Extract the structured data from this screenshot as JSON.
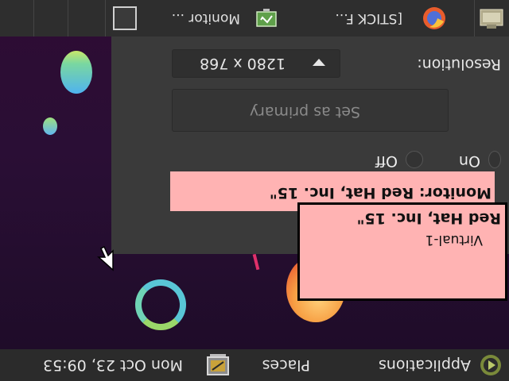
{
  "top_panel": {
    "applications": "Applications",
    "places": "Places",
    "clock": "Mon Oct 23, 09:53"
  },
  "bottom_panel": {
    "tasks": [
      {
        "label": "Monitor ..."
      },
      {
        "label": "[STICK F..."
      }
    ]
  },
  "monitor_label": {
    "name": "Red Hat, Inc. 15\"",
    "connector": "Virtual-1"
  },
  "dialog": {
    "monitor_title": "Monitor: Red Hat, Inc. 15\"",
    "power_on": "On",
    "power_off": "Off",
    "set_primary": "Set as primary",
    "resolution_label": "Resolution:",
    "resolution_value": "1280 x 768"
  },
  "colors": {
    "panel_bg": "#2b2b2b",
    "dialog_bg": "#3a3a3a",
    "label_pink": "#ffb3b3",
    "desktop_purple": "#2a0e35"
  }
}
